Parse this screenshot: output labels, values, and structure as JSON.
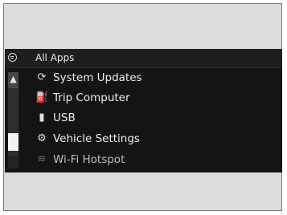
{
  "header": {
    "title": "All Apps",
    "icon": "menu-circle-icon"
  },
  "scrollbar": {
    "up_glyph": "▲"
  },
  "items": [
    {
      "label": "System Updates",
      "icon": "refresh-icon",
      "glyph": "⟳"
    },
    {
      "label": "Trip Computer",
      "icon": "fuel-gauge-icon",
      "glyph": "⛽"
    },
    {
      "label": "USB",
      "icon": "usb-icon",
      "glyph": "▮"
    },
    {
      "label": "Vehicle Settings",
      "icon": "car-settings-icon",
      "glyph": "⚙"
    },
    {
      "label": "Wi-Fi Hotspot",
      "icon": "wifi-icon",
      "glyph": "≋"
    }
  ]
}
